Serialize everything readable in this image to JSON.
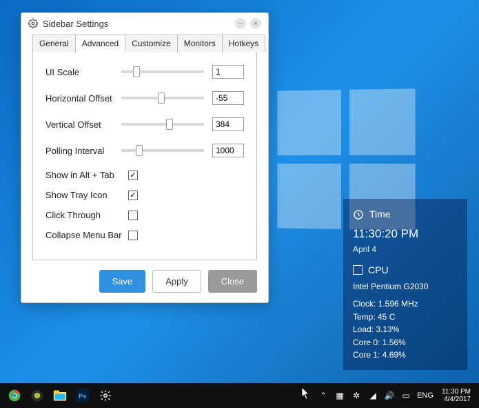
{
  "window": {
    "title": "Sidebar Settings",
    "tabs": [
      "General",
      "Advanced",
      "Customize",
      "Monitors",
      "Hotkeys"
    ],
    "active_tab": 1,
    "sliders": [
      {
        "label": "UI Scale",
        "value": "1",
        "thumb_pct": 18
      },
      {
        "label": "Horizontal Offset",
        "value": "-55",
        "thumb_pct": 48
      },
      {
        "label": "Vertical Offset",
        "value": "384",
        "thumb_pct": 58
      },
      {
        "label": "Polling Interval",
        "value": "1000",
        "thumb_pct": 22
      }
    ],
    "checkboxes": [
      {
        "label": "Show in Alt + Tab",
        "checked": true
      },
      {
        "label": "Show Tray Icon",
        "checked": true
      },
      {
        "label": "Click Through",
        "checked": false
      },
      {
        "label": "Collapse Menu Bar",
        "checked": false
      }
    ],
    "buttons": {
      "save": "Save",
      "apply": "Apply",
      "close": "Close"
    }
  },
  "sidebar_widget": {
    "time_label": "Time",
    "time_value": "11:30:20 PM",
    "date_value": "April 4",
    "cpu_label": "CPU",
    "cpu_name": "Intel Pentium G2030",
    "stats": [
      "Clock: 1.596 MHz",
      "Temp: 45 C",
      "Load: 3.13%",
      "Core 0: 1.56%",
      "Core 1: 4.69%"
    ]
  },
  "taskbar": {
    "lang": "ENG",
    "time": "11:30 PM",
    "date": "4/4/2017"
  }
}
